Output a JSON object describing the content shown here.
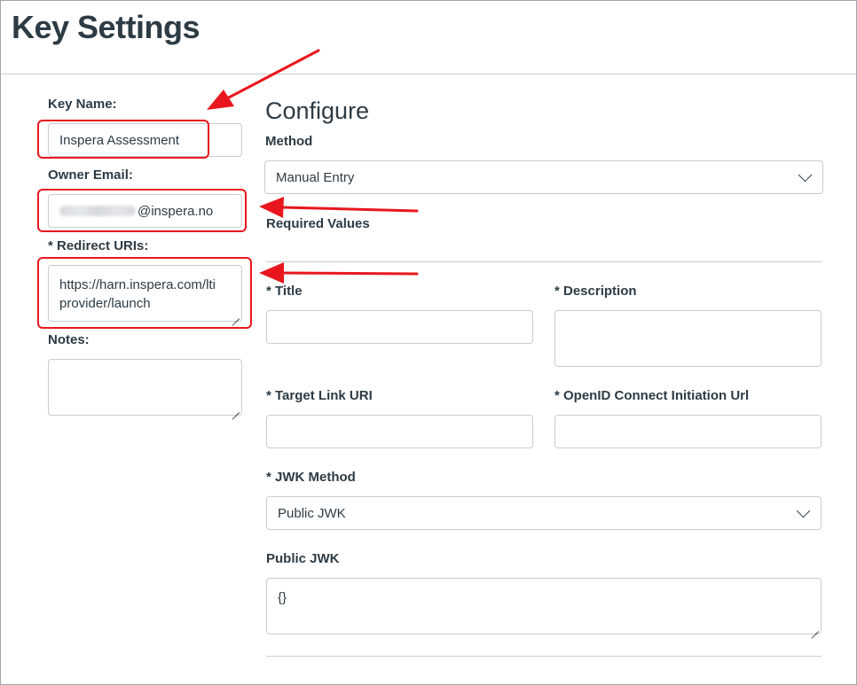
{
  "header": {
    "title": "Key Settings"
  },
  "left": {
    "key_name": {
      "label": "Key Name:",
      "value": "Inspera Assessment"
    },
    "owner_email": {
      "label": "Owner Email:",
      "value_suffix": "@inspera.no"
    },
    "redirect_uris": {
      "label": "* Redirect URIs:",
      "value": "https://harn.inspera.com/lti\nprovider/launch"
    },
    "notes": {
      "label": "Notes:",
      "value": ""
    }
  },
  "configure": {
    "title": "Configure",
    "method": {
      "label": "Method",
      "selected": "Manual Entry"
    },
    "required_values_label": "Required Values",
    "title_field": {
      "label": "* Title",
      "value": ""
    },
    "description_field": {
      "label": "* Description",
      "value": ""
    },
    "target_link_uri": {
      "label": "* Target Link URI",
      "value": ""
    },
    "openid_url": {
      "label": "* OpenID Connect Initiation Url",
      "value": ""
    },
    "jwk_method": {
      "label": "* JWK Method",
      "selected": "Public JWK"
    },
    "public_jwk": {
      "label": "Public JWK",
      "value": "{}"
    }
  },
  "colors": {
    "highlight": "#e8171d",
    "text": "#2d3b45",
    "border": "#c7cdd1"
  },
  "icons": [
    "chevron-down-icon",
    "resize-handle-icon",
    "annotation-arrow"
  ]
}
